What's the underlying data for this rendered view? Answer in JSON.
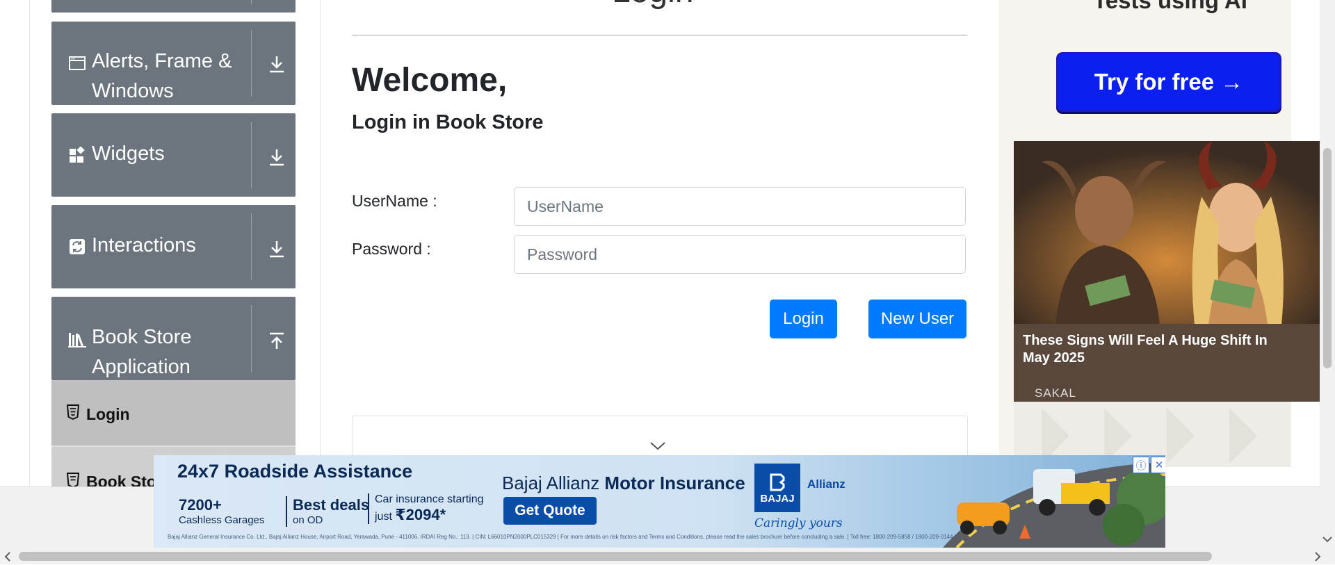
{
  "page": {
    "title": "Login"
  },
  "sidebar": {
    "groups": [
      {
        "label": "Alerts, Frame & Windows",
        "icon": "window-icon",
        "expanded": false
      },
      {
        "label": "Widgets",
        "icon": "widgets-icon",
        "expanded": false
      },
      {
        "label": "Interactions",
        "icon": "interactions-icon",
        "expanded": false
      },
      {
        "label": "Book Store Application",
        "icon": "bookshelf-icon",
        "expanded": true
      }
    ],
    "subitems": [
      {
        "label": "Login",
        "icon": "html5-icon",
        "active": true
      },
      {
        "label": "Book Sto",
        "icon": "html5-icon",
        "active": false
      }
    ]
  },
  "main": {
    "welcome": "Welcome,",
    "subtitle": "Login in Book Store",
    "username": {
      "label": "UserName :",
      "placeholder": "UserName",
      "value": ""
    },
    "password": {
      "label": "Password :",
      "placeholder": "Password",
      "value": ""
    },
    "login_button": "Login",
    "new_user_button": "New User"
  },
  "right_ad": {
    "headline": "Tests using AI",
    "cta": "Try for free →",
    "card_caption": "These Signs Will Feel A Huge Shift In May 2025",
    "card_source": "SAKAL"
  },
  "bottom_ad": {
    "headline": "24x7 Roadside Assistance",
    "stat1_big": "7200+",
    "stat1_small": "Cashless Garages",
    "stat2_big": "Best deals",
    "stat2_small": "on OD",
    "stat3_small": "Car insurance starting",
    "stat3_prefix": "just ",
    "stat3_price": "₹2094*",
    "brand_prefix": "Bajaj Allianz ",
    "brand_bold": "Motor Insurance",
    "cta": "Get Quote",
    "logo_text": "BAJAJ",
    "partner": "Allianz",
    "tagline": "Caringly yours",
    "fine_print": "Bajaj Allianz General Insurance Co. Ltd., Bajaj Allianz House, Airport Road, Yerawada, Pune - 411006. IRDAI Reg No.: 113. | CIN: L66010PN2000PLC015329 | For more details on risk factors and Terms and Conditions, please read the sales brochure before concluding a sale. | Toll free: 1800-209-5858 / 1800-209-0144"
  },
  "colors": {
    "sidebar_group": "#6c757d",
    "sidebar_subitem_active": "#bfbfbf",
    "primary_button": "#007bff",
    "ad_cta": "#0a1ff0"
  }
}
